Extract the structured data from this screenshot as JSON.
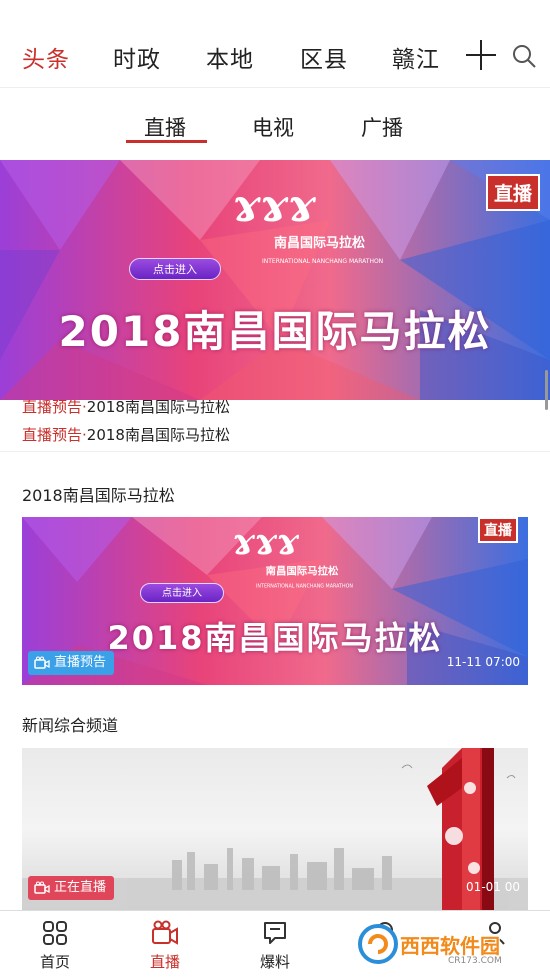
{
  "top_nav": {
    "tabs": [
      "头条",
      "时政",
      "本地",
      "区县",
      "赣江"
    ],
    "active_index": 0
  },
  "sub_tabs": {
    "tabs": [
      "直播",
      "电视",
      "广播"
    ],
    "active_index": 0
  },
  "banner": {
    "title": "2018南昌国际马拉松",
    "enter_label": "点击进入",
    "live_badge": "直播",
    "logo_cn": "南昌国际马拉松",
    "logo_en": "INTERNATIONAL NANCHANG MARATHON"
  },
  "ticker": {
    "items": [
      {
        "key": "直播预告·",
        "value": "2018南昌国际马拉松"
      },
      {
        "key": "直播预告·",
        "value": "2018南昌国际马拉松"
      }
    ]
  },
  "sections": [
    {
      "title": "2018南昌国际马拉松",
      "tag": "直播预告",
      "time": "11-11 07:00",
      "enter_label": "点击进入",
      "live_badge": "直播",
      "banner_title": "2018南昌国际马拉松"
    },
    {
      "title": "新闻综合频道",
      "tag": "正在直播",
      "time": "01-01 00"
    }
  ],
  "bottom_nav": {
    "items": [
      {
        "label": "首页",
        "icon": "grid-icon"
      },
      {
        "label": "直播",
        "icon": "camera-icon"
      },
      {
        "label": "爆料",
        "icon": "chat-icon"
      }
    ],
    "active_index": 1
  },
  "watermark": {
    "text": "西西软件园",
    "sub": "CR173.COM"
  },
  "colors": {
    "accent": "#c9302c",
    "tag_blue": "#3aa0e8",
    "tag_red": "#e0465a"
  }
}
